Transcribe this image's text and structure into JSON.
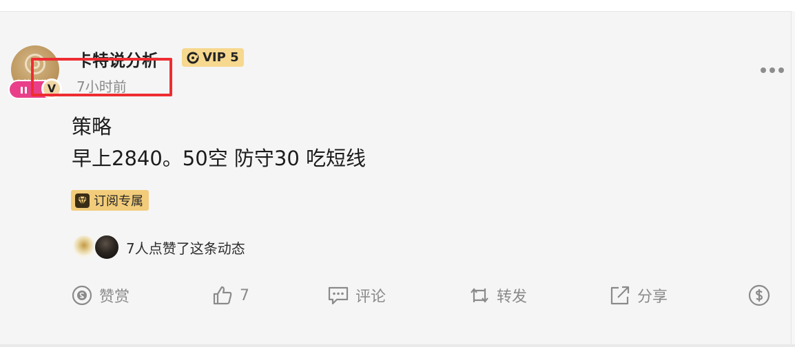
{
  "post": {
    "author": {
      "name": "卡特说分析",
      "avatar_text": "卡特说分析",
      "verified_mark": "V",
      "vip_label": "VIP 5"
    },
    "timestamp": "7小时前",
    "content_lines": [
      "策略",
      "早上2840。50空 防守30 吃短线"
    ],
    "tag": "订阅专属",
    "likes_summary": "7人点赞了这条动态",
    "actions": {
      "reward_label": "赞赏",
      "like_count": "7",
      "comment_label": "评论",
      "repost_label": "转发",
      "share_label": "分享"
    }
  },
  "icons": {
    "menu": "more-dots-icon",
    "reward": "coin-circle-icon",
    "like": "thumbs-up-icon",
    "comment": "comment-bubble-icon",
    "repost": "repost-arrows-icon",
    "share": "share-out-icon",
    "tip": "dollar-circle-icon"
  },
  "colors": {
    "highlight_box": "#ee2d32",
    "vip_badge": "#f6d88f",
    "subscription_tag": "#f2cc7a",
    "live_badge": "#e93f8a"
  }
}
